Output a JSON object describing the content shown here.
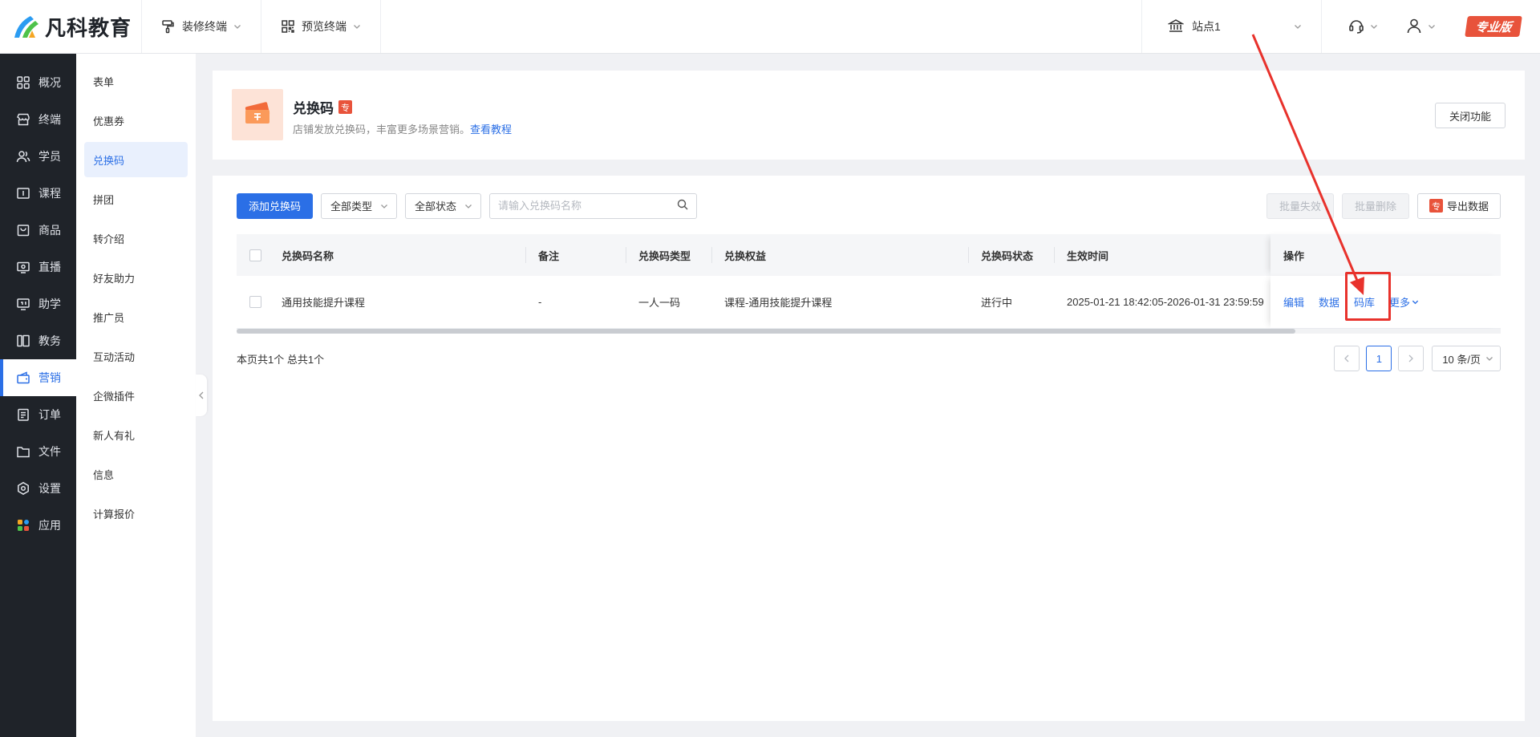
{
  "brand": {
    "name": "凡科教育"
  },
  "topbar": {
    "decorate": "装修终端",
    "preview": "预览终端",
    "site": "站点1",
    "edition": "专业版"
  },
  "side_main": [
    {
      "label": "概况",
      "icon": "grid-icon"
    },
    {
      "label": "终端",
      "icon": "store-icon"
    },
    {
      "label": "学员",
      "icon": "users-icon"
    },
    {
      "label": "课程",
      "icon": "course-icon"
    },
    {
      "label": "商品",
      "icon": "bag-icon"
    },
    {
      "label": "直播",
      "icon": "live-icon"
    },
    {
      "label": "助学",
      "icon": "assist-icon"
    },
    {
      "label": "教务",
      "icon": "book-icon"
    },
    {
      "label": "营销",
      "icon": "marketing-icon",
      "active": true
    },
    {
      "label": "订单",
      "icon": "order-icon"
    },
    {
      "label": "文件",
      "icon": "folder-icon"
    },
    {
      "label": "设置",
      "icon": "settings-icon"
    },
    {
      "label": "应用",
      "icon": "apps-icon"
    }
  ],
  "side_sub": [
    {
      "label": "表单"
    },
    {
      "label": "优惠券"
    },
    {
      "label": "兑换码",
      "active": true
    },
    {
      "label": "拼团"
    },
    {
      "label": "转介绍"
    },
    {
      "label": "好友助力"
    },
    {
      "label": "推广员"
    },
    {
      "label": "互动活动"
    },
    {
      "label": "企微插件"
    },
    {
      "label": "新人有礼"
    },
    {
      "label": "信息"
    },
    {
      "label": "计算报价"
    }
  ],
  "header": {
    "title": "兑换码",
    "pro_tag": "专",
    "desc": "店铺发放兑换码，丰富更多场景营销。",
    "tutorial_link": "查看教程",
    "close_btn": "关闭功能"
  },
  "toolbar": {
    "add_btn": "添加兑换码",
    "type_select": "全部类型",
    "status_select": "全部状态",
    "search_placeholder": "请输入兑换码名称",
    "batch_invalid": "批量失效",
    "batch_delete": "批量删除",
    "export_tag": "专",
    "export_btn": "导出数据"
  },
  "table": {
    "columns": {
      "name": "兑换码名称",
      "remark": "备注",
      "type": "兑换码类型",
      "benefit": "兑换权益",
      "status": "兑换码状态",
      "time": "生效时间",
      "ops": "操作"
    },
    "rows": [
      {
        "name": "通用技能提升课程",
        "remark": "-",
        "type": "一人一码",
        "benefit": "课程-通用技能提升课程",
        "status": "进行中",
        "time": "2025-01-21 18:42:05-2026-01-31 23:59:59",
        "ops": {
          "edit": "编辑",
          "data": "数据",
          "library": "码库",
          "more": "更多"
        }
      }
    ]
  },
  "pager": {
    "info": "本页共1个 总共1个",
    "current": "1",
    "size": "10 条/页"
  },
  "colors": {
    "primary": "#2b6fe6",
    "danger": "#e8533b",
    "sidebar": "#1f2329"
  }
}
